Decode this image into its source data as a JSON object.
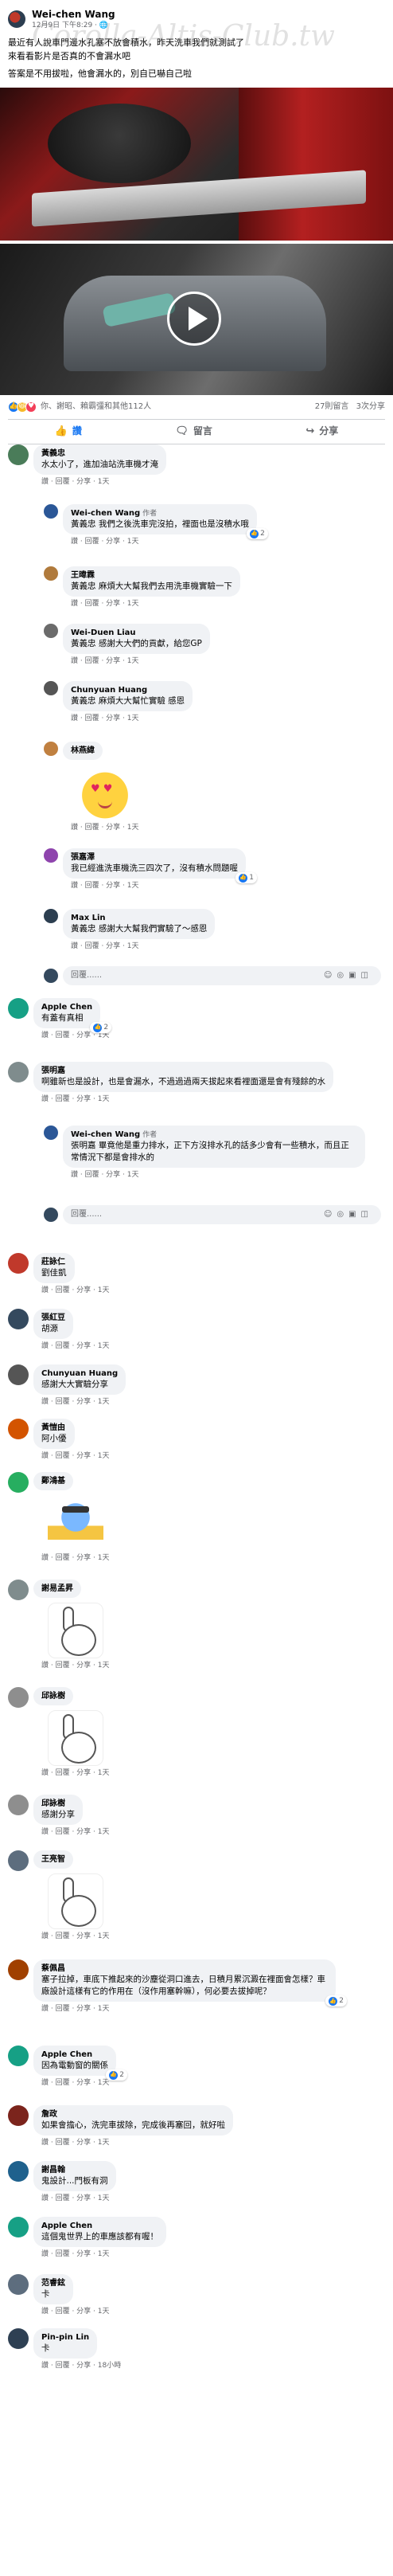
{
  "post": {
    "author": "Wei-chen Wang",
    "timestamp": "12月9日 下午8:29",
    "watermark": "Corolla-Altis-Club.tw",
    "text_line1": "最近有人說車門邊水孔塞不放會積水，昨天洗車我們就測試了",
    "text_line2": "來看看影片是否真的不會漏水吧",
    "text_line3": "答案是不用拔啦，他會漏水的，別自已嚇自己啦",
    "reactions_summary": "你、謝昭、賴霸彊和其他112人",
    "comments_count": "27則留言",
    "shares_count": "3次分享",
    "colors": {
      "accent": "#1877f2",
      "bubble": "#f0f2f5"
    }
  },
  "actions": {
    "like": "讚",
    "comment": "留言",
    "share": "分享"
  },
  "labels": {
    "author_badge": "作者",
    "reply_placeholder": "回覆......"
  },
  "comments": [
    {
      "name": "黃義忠",
      "text": "水太小了，進加油站洗車機才淹",
      "meta": "讚 · 回覆 · 分享 · 1天"
    },
    {
      "name": "Wei-chen Wang",
      "author": true,
      "text": "黃義忠 我們之後洗車完沒拍，裡面也是沒積水哦",
      "meta": "讚 · 回覆 · 分享 · 1天",
      "rx": "2"
    },
    {
      "name": "王暐霖",
      "text": "黃義忠 麻煩大大幫我們去用洗車機實驗一下",
      "meta": "讚 · 回覆 · 分享 · 1天"
    },
    {
      "name": "Wei-Duen Liau",
      "text": "黃義忠 感謝大大們的貢獻，給您GP",
      "meta": "讚 · 回覆 · 分享 · 1天"
    },
    {
      "name": "Chunyuan Huang",
      "text": "黃義忠 麻煩大大幫忙實驗 感恩",
      "meta": "讚 · 回覆 · 分享 · 1天"
    },
    {
      "name": "林燕緯",
      "text": "",
      "meta": "讚 · 回覆 · 分享 · 1天"
    },
    {
      "name": "張嘉澤",
      "text": "我已經進洗車機洗三四次了，沒有積水問題喔",
      "meta": "讚 · 回覆 · 分享 · 1天",
      "rx": "1"
    },
    {
      "name": "Max Lin",
      "text": "黃義忠 感謝大大幫我們實驗了～感恩",
      "meta": "讚 · 回覆 · 分享 · 1天"
    },
    {
      "name": "Apple Chen",
      "text": "有蓋有真相",
      "meta": "讚 · 回覆 · 分享 · 1天",
      "rx": "2"
    },
    {
      "name": "張明嘉",
      "text": "啊雖新也是設計，也是會漏水，不過過過兩天拔起來看裡面還是會有殘餘的水",
      "meta": "讚 · 回覆 · 分享 · 1天"
    },
    {
      "name": "Wei-chen Wang",
      "author": true,
      "text": "張明嘉 畢竟他是重力排水，正下方沒排水孔的話多少會有一些積水，而且正常情況下都是會排水的",
      "meta": "讚 · 回覆 · 分享 · 1天"
    },
    {
      "name": "莊詠仁",
      "text": "劉佳凱",
      "meta": "讚 · 回覆 · 分享 · 1天"
    },
    {
      "name": "張紅豆",
      "text": "胡源",
      "meta": "讚 · 回覆 · 分享 · 1天"
    },
    {
      "name": "Chunyuan Huang",
      "text": "感謝大大實驗分享",
      "meta": "讚 · 回覆 · 分享 · 1天"
    },
    {
      "name": "黃愷由",
      "text": "阿小優",
      "meta": "讚 · 回覆 · 分享 · 1天"
    },
    {
      "name": "鄭鴻基",
      "text": "",
      "meta": "讚 · 回覆 · 分享 · 1天"
    },
    {
      "name": "謝易孟昇",
      "text": "",
      "meta": "讚 · 回覆 · 分享 · 1天"
    },
    {
      "name": "邱詠樹",
      "text": "",
      "meta": "讚 · 回覆 · 分享 · 1天"
    },
    {
      "name": "邱詠樹",
      "text": "感謝分享",
      "meta": "讚 · 回覆 · 分享 · 1天"
    },
    {
      "name": "王亮智",
      "text": "",
      "meta": "讚 · 回覆 · 分享 · 1天"
    },
    {
      "name": "蔡佩昌",
      "text": "塞子拉掉，車底下推起來的沙塵從洞口進去，日積月累沉澱在裡面會怎樣？車廠設計這樣有它的作用在（沒作用塞幹嘛），何必要去拔掉呢？",
      "meta": "讚 · 回覆 · 分享 · 1天",
      "rx": "2"
    },
    {
      "name": "Apple Chen",
      "text": "因為電動窗的關係",
      "meta": "讚 · 回覆 · 分享 · 1天",
      "rx": "2"
    },
    {
      "name": "詹政",
      "text": "如果會擔心，洗完車拔除，完成後再塞回，就好啦",
      "meta": "讚 · 回覆 · 分享 · 1天"
    },
    {
      "name": "謝昌翰",
      "text": "鬼設計...門板有洞",
      "meta": "讚 · 回覆 · 分享 · 1天"
    },
    {
      "name": "Apple Chen",
      "text": "這個鬼世界上的車應該都有喔！",
      "meta": "讚 · 回覆 · 分享 · 1天"
    },
    {
      "name": "范睿鉉",
      "text": "卡",
      "meta": "讚 · 回覆 · 分享 · 1天"
    },
    {
      "name": "Pin-pin Lin",
      "text": "卡",
      "meta": "讚 · 回覆 · 分享 · 18小時"
    }
  ]
}
